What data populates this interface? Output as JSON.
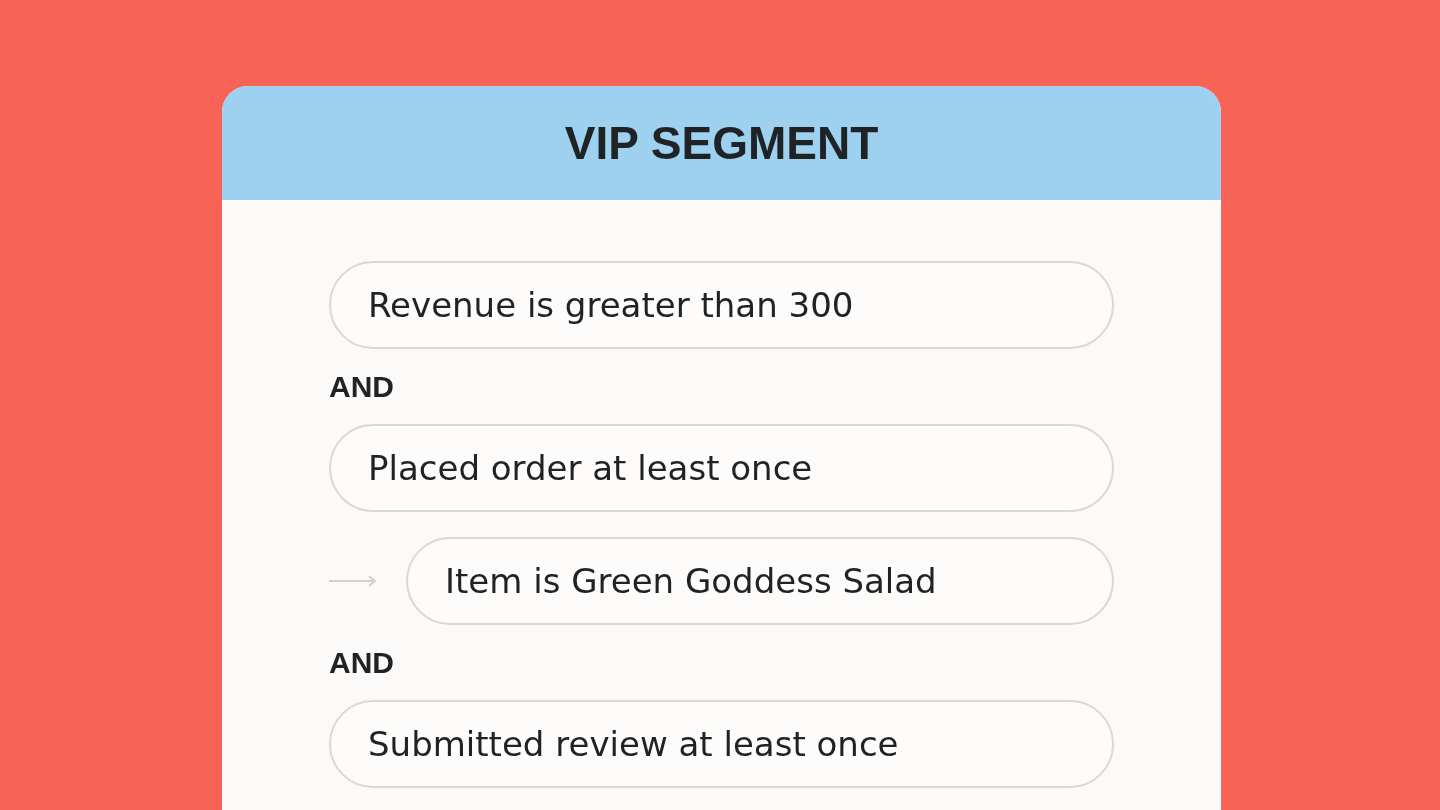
{
  "card": {
    "title": "VIP SEGMENT",
    "rows": [
      {
        "kind": "condition",
        "text": "Revenue is greater than 300"
      },
      {
        "kind": "operator",
        "text": "AND"
      },
      {
        "kind": "condition",
        "text": "Placed order at least once"
      },
      {
        "kind": "sub_condition",
        "text": "Item is Green Goddess Salad"
      },
      {
        "kind": "operator",
        "text": "AND"
      },
      {
        "kind": "condition",
        "text": "Submitted review at least once"
      }
    ]
  }
}
